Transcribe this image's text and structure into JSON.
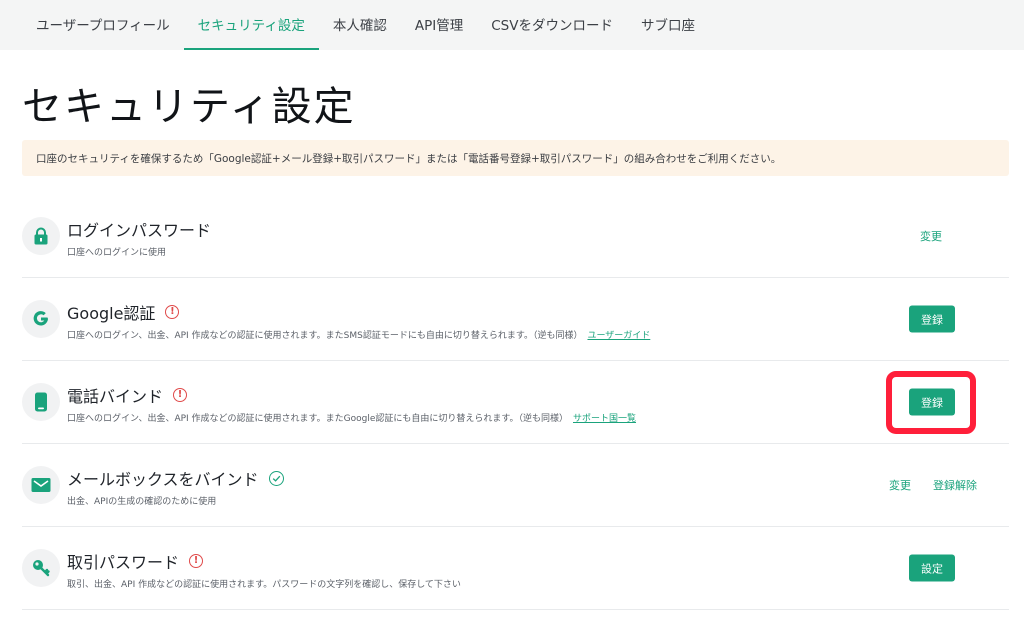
{
  "nav": {
    "tabs": [
      {
        "label": "ユーザープロフィール"
      },
      {
        "label": "セキュリティ設定"
      },
      {
        "label": "本人確認"
      },
      {
        "label": "API管理"
      },
      {
        "label": "CSVをダウンロード"
      },
      {
        "label": "サブ口座"
      }
    ],
    "active_index": 1
  },
  "page_title": "セキュリティ設定",
  "notice": "口座のセキュリティを確保するため「Google認証+メール登録+取引パスワード」または「電話番号登録+取引パスワード」の組み合わせをご利用ください。",
  "items": [
    {
      "title": "ログインパスワード",
      "desc": "口座へのログインに使用",
      "icon": "lock-icon",
      "status": "none",
      "actions": [
        {
          "label": "変更",
          "style": "link"
        }
      ]
    },
    {
      "title": "Google認証",
      "desc": "口座へのログイン、出金、API 作成などの認証に使用されます。またSMS認証モードにも自由に切り替えられます。（逆も同様）",
      "link": "ユーザーガイド",
      "icon": "google-icon",
      "status": "warning",
      "actions": [
        {
          "label": "登録",
          "style": "button"
        }
      ]
    },
    {
      "title": "電話バインド",
      "desc": "口座へのログイン、出金、API 作成などの認証に使用されます。またGoogle認証にも自由に切り替えられます。（逆も同様）",
      "link": "サポート国一覧",
      "icon": "phone-icon",
      "status": "warning",
      "actions": [
        {
          "label": "登録",
          "style": "button"
        }
      ]
    },
    {
      "title": "メールボックスをバインド",
      "desc": "出金、APIの生成の確認のために使用",
      "icon": "mail-icon",
      "status": "verified",
      "actions": [
        {
          "label": "変更",
          "style": "link"
        },
        {
          "label": "登録解除",
          "style": "link"
        }
      ]
    },
    {
      "title": "取引パスワード",
      "desc": "取引、出金、API 作成などの認証に使用されます。パスワードの文字列を確認し、保存して下さい",
      "icon": "key-icon",
      "status": "warning",
      "actions": [
        {
          "label": "設定",
          "style": "button"
        }
      ]
    }
  ],
  "warning_glyph": "!",
  "colors": {
    "accent": "#1aa37c",
    "warning": "#e04a4a",
    "highlight": "#ff1f3a",
    "notice_bg": "#fdf3e7",
    "nav_bg": "#f4f5f5"
  }
}
